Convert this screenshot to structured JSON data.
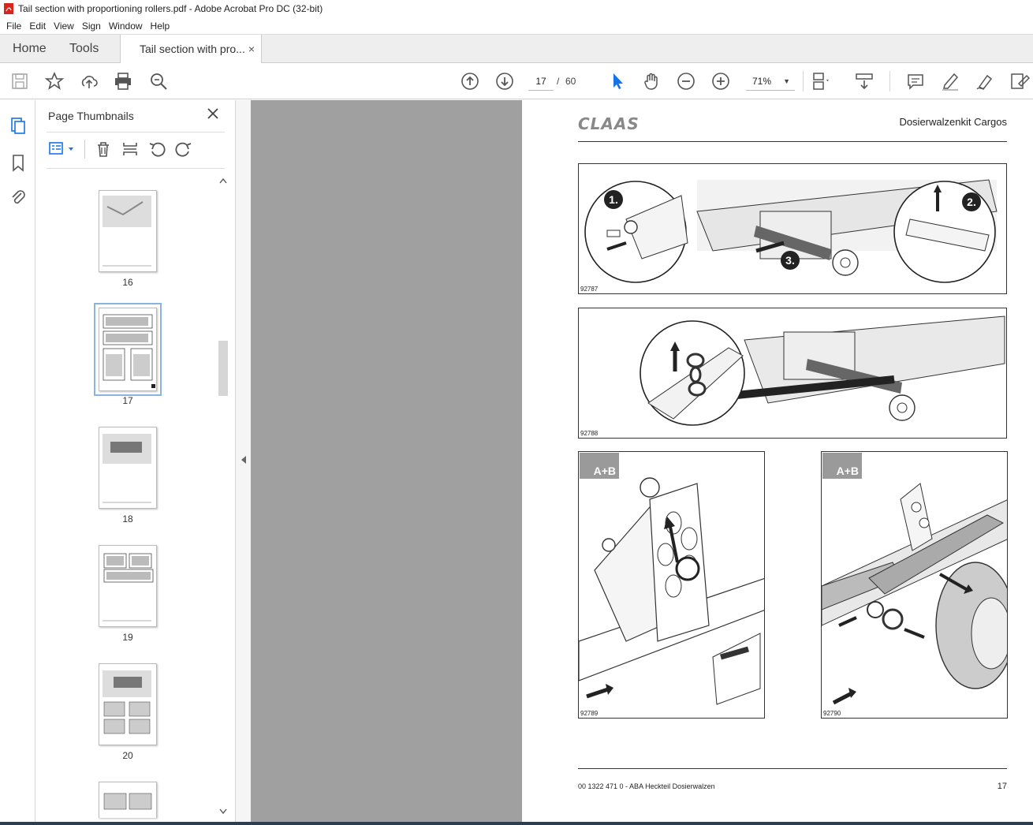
{
  "window": {
    "title": "Tail section with proportioning rollers.pdf - Adobe Acrobat Pro DC (32-bit)"
  },
  "menu": [
    "File",
    "Edit",
    "View",
    "Sign",
    "Window",
    "Help"
  ],
  "tabs": {
    "home": "Home",
    "tools": "Tools",
    "document": "Tail section with pro...",
    "close": "×"
  },
  "toolbar": {
    "current_page": "17",
    "page_separator": "/",
    "total_pages": "60",
    "zoom": "71%"
  },
  "panel": {
    "title": "Page Thumbnails",
    "thumbnails": [
      {
        "label": "16"
      },
      {
        "label": "17",
        "selected": true
      },
      {
        "label": "18"
      },
      {
        "label": "19"
      },
      {
        "label": "20"
      }
    ]
  },
  "document_page": {
    "brand": "CLAAS",
    "header_title": "Dosierwalzenkit Cargos",
    "figures": [
      {
        "id": "92787",
        "callouts": [
          "1.",
          "2.",
          "3."
        ]
      },
      {
        "id": "92788"
      },
      {
        "id": "92789",
        "tag": "A+B"
      },
      {
        "id": "92790",
        "tag": "A+B"
      }
    ],
    "footer_text": "00 1322 471 0 - ABA Heckteil Dosierwalzen",
    "page_number": "17"
  }
}
